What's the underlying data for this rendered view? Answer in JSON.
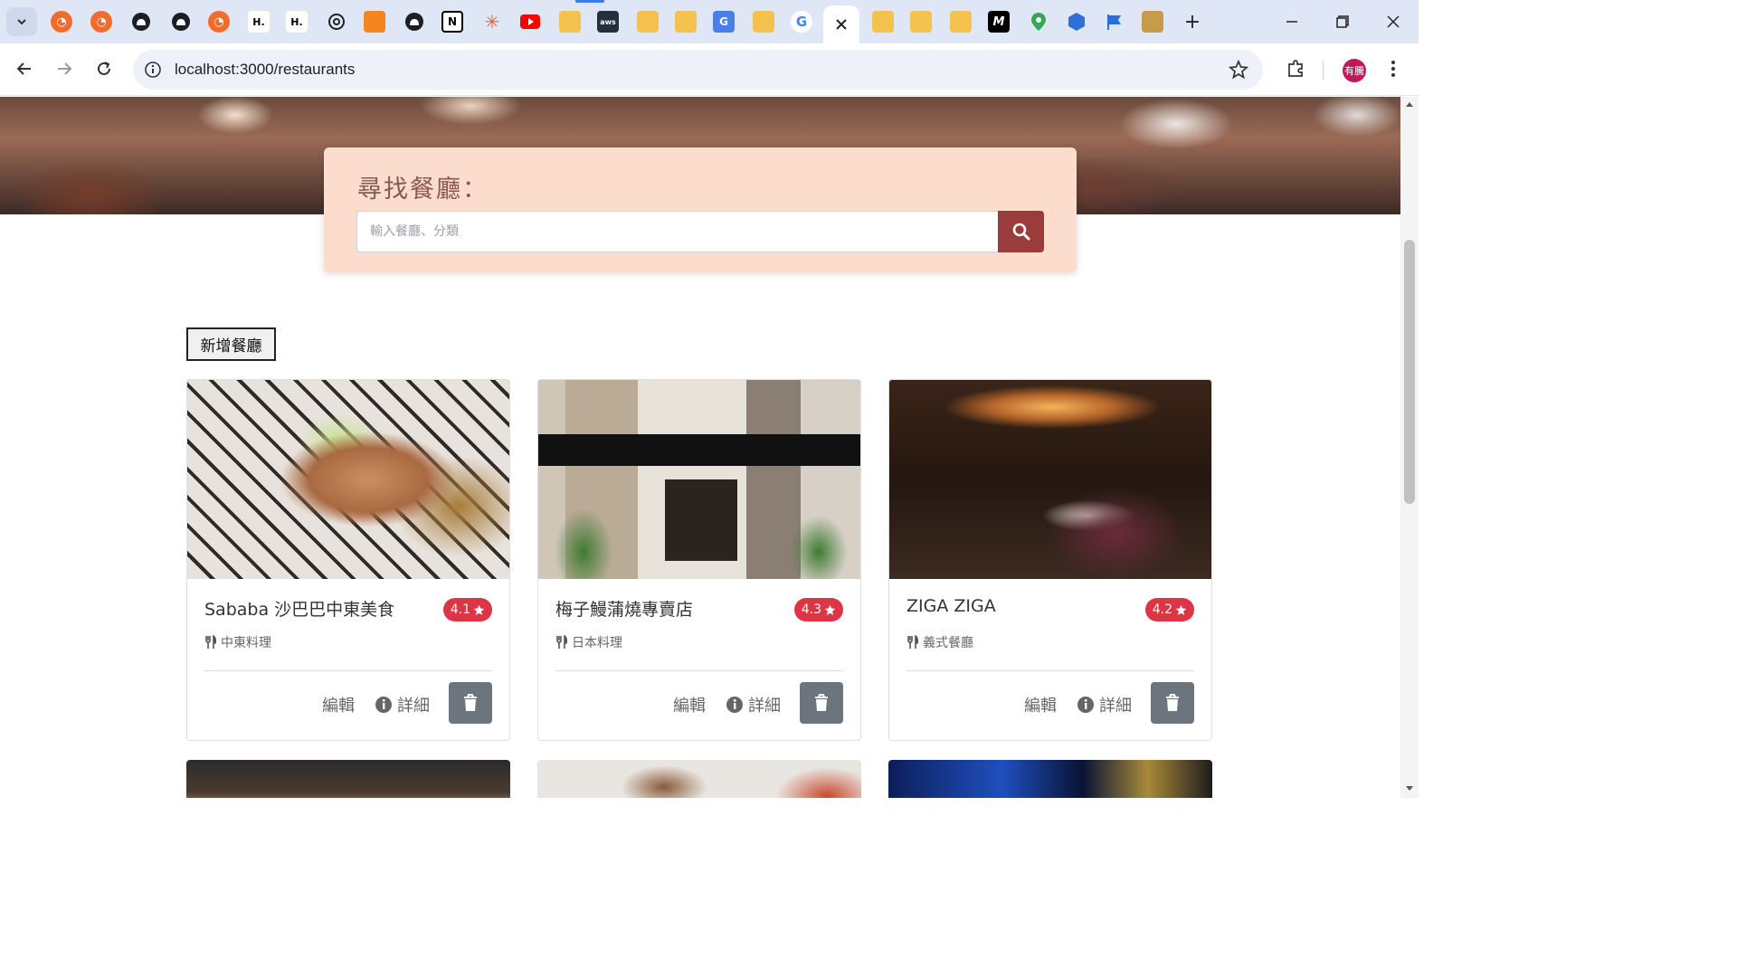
{
  "browser": {
    "url": "localhost:3000/restaurants",
    "profile_label": "有騰"
  },
  "page": {
    "search_title": "尋找餐廳：",
    "search_placeholder": "輸入餐廳、分類",
    "add_button": "新增餐廳",
    "edit_label": "編輯",
    "detail_label": "詳細",
    "accent_color": "#9b3c3c",
    "rating_color": "#dc3545"
  },
  "restaurants": [
    {
      "name": "Sababa 沙巴巴中東美食",
      "rating": "4.1",
      "category": "中東料理"
    },
    {
      "name": "梅子鰻蒲燒專賣店",
      "rating": "4.3",
      "category": "日本料理"
    },
    {
      "name": "ZIGA ZIGA",
      "rating": "4.2",
      "category": "義式餐廳"
    }
  ]
}
